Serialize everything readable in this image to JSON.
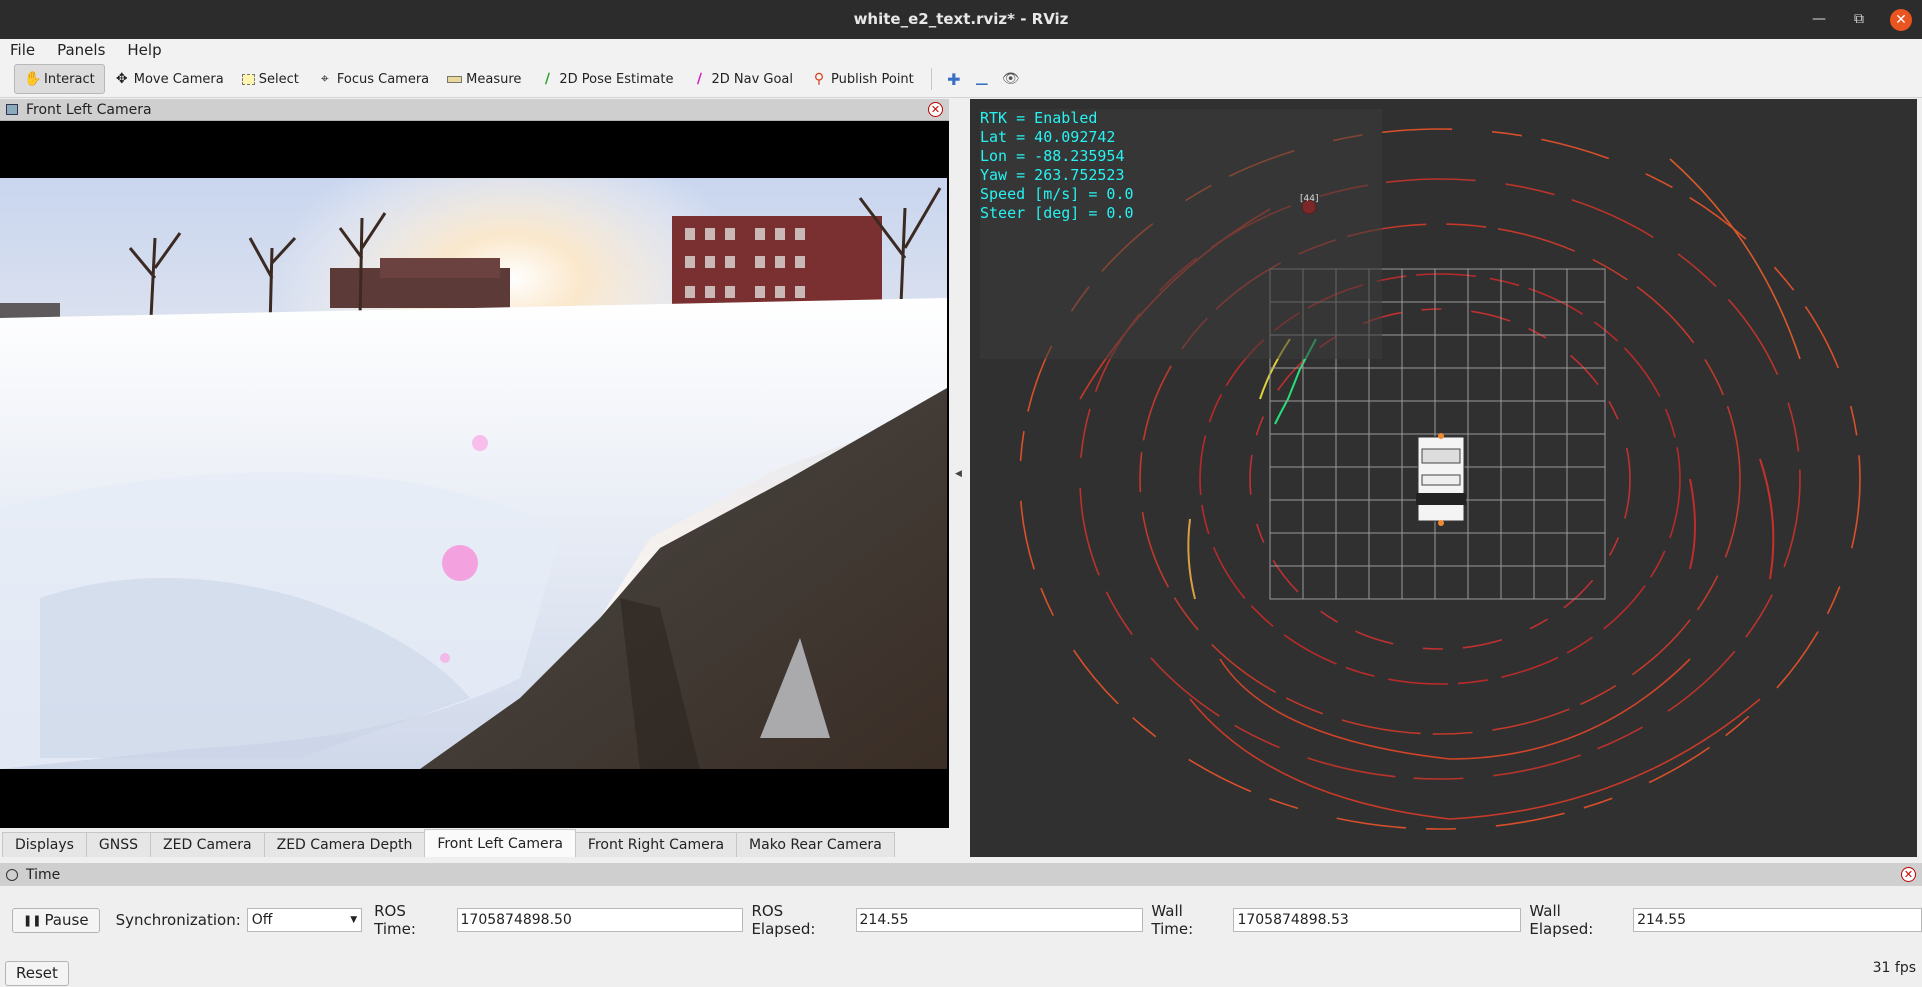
{
  "window": {
    "title": "white_e2_text.rviz* - RViz"
  },
  "menu": [
    "File",
    "Panels",
    "Help"
  ],
  "toolbar": {
    "tools": [
      {
        "label": "Interact",
        "icon": "hand-icon",
        "active": true
      },
      {
        "label": "Move Camera",
        "icon": "move-camera-icon"
      },
      {
        "label": "Select",
        "icon": "select-icon"
      },
      {
        "label": "Focus Camera",
        "icon": "focus-camera-icon"
      },
      {
        "label": "Measure",
        "icon": "measure-icon"
      },
      {
        "label": "2D Pose Estimate",
        "icon": "pose-estimate-icon"
      },
      {
        "label": "2D Nav Goal",
        "icon": "nav-goal-icon"
      },
      {
        "label": "Publish Point",
        "icon": "publish-point-icon"
      }
    ]
  },
  "camera_panel": {
    "title": "Front Left Camera"
  },
  "tabs": [
    {
      "label": "Displays"
    },
    {
      "label": "GNSS"
    },
    {
      "label": "ZED Camera"
    },
    {
      "label": "ZED Camera Depth"
    },
    {
      "label": "Front Left Camera",
      "active": true
    },
    {
      "label": "Front Right Camera"
    },
    {
      "label": "Mako Rear Camera"
    }
  ],
  "overlay": {
    "lines": [
      "RTK = Enabled",
      "Lat = 40.092742",
      "Lon = -88.235954",
      "Yaw = 263.752523",
      "Speed [m/s] = 0.0",
      "Steer [deg] = 0.0"
    ],
    "marker_label": "[44]",
    "text_color": "#27f3f3"
  },
  "time_panel": {
    "title": "Time",
    "pause_label": "Pause",
    "sync_label": "Synchronization:",
    "sync_value": "Off",
    "ros_time_label": "ROS Time:",
    "ros_time": "1705874898.50",
    "ros_elapsed_label": "ROS Elapsed:",
    "ros_elapsed": "214.55",
    "wall_time_label": "Wall Time:",
    "wall_time": "1705874898.53",
    "wall_elapsed_label": "Wall Elapsed:",
    "wall_elapsed": "214.55",
    "reset_label": "Reset",
    "fps": "31 fps"
  }
}
